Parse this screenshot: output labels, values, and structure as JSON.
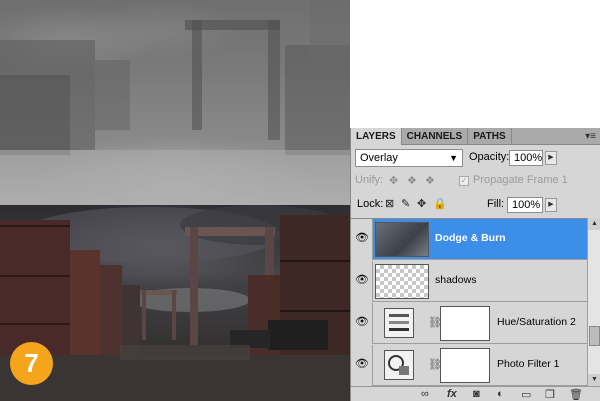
{
  "step_badge": "7",
  "layers_panel": {
    "tabs": [
      {
        "label": "LAYERS",
        "active": true
      },
      {
        "label": "CHANNELS",
        "active": false
      },
      {
        "label": "PATHS",
        "active": false
      }
    ],
    "menu_icon": "panel-menu-icon",
    "blend_mode": "Overlay",
    "opacity_label": "Opacity:",
    "opacity_value": "100%",
    "unify_label": "Unify:",
    "propagate_label": "Propagate Frame 1",
    "lock_label": "Lock:",
    "fill_label": "Fill:",
    "fill_value": "100%",
    "layers": [
      {
        "name": "Dodge & Burn",
        "selected": true,
        "visible": true,
        "thumb": "photo"
      },
      {
        "name": "shadows",
        "selected": false,
        "visible": true,
        "thumb": "transparent"
      },
      {
        "name": "Hue/Saturation 2",
        "selected": false,
        "visible": true,
        "thumb": "hue-saturation-adjustment"
      },
      {
        "name": "Photo Filter 1",
        "selected": false,
        "visible": true,
        "thumb": "photo-filter-adjustment"
      }
    ],
    "bottom_icons": [
      "link-icon",
      "fx-icon",
      "add-mask-icon",
      "adjustment-layer-icon",
      "group-folder-icon",
      "new-layer-icon",
      "trash-icon"
    ],
    "colors": {
      "selected": "#3d8ee8",
      "panel_bg": "#d6d6d6",
      "badge": "#f4a51c"
    }
  }
}
